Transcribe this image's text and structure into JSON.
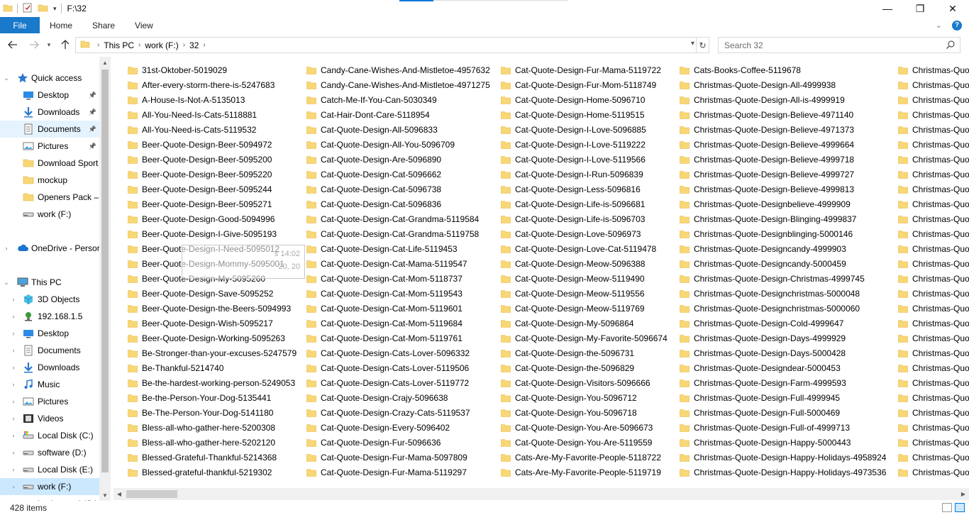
{
  "window": {
    "title": "F:\\32",
    "controls": {
      "minimize": "—",
      "maximize": "❐",
      "close": "✕"
    }
  },
  "ribbon": {
    "tabs": [
      "File",
      "Home",
      "Share",
      "View"
    ],
    "expand_icon": "chevron-down-icon",
    "help_label": "?"
  },
  "address": {
    "crumbs": [
      "This PC",
      "work (F:)",
      "32"
    ],
    "search_placeholder": "Search 32"
  },
  "nav": {
    "items": [
      {
        "label": "Quick access",
        "level": 0,
        "icon": "star",
        "chev": "expanded"
      },
      {
        "label": "Desktop",
        "level": 1,
        "icon": "desktop",
        "pin": true
      },
      {
        "label": "Downloads",
        "level": 1,
        "icon": "download",
        "pin": true
      },
      {
        "label": "Documents",
        "level": 1,
        "icon": "documents",
        "pin": true,
        "state": "hover"
      },
      {
        "label": "Pictures",
        "level": 1,
        "icon": "pictures",
        "pin": true
      },
      {
        "label": "Download Sport",
        "level": 1,
        "icon": "folder"
      },
      {
        "label": "mockup",
        "level": 1,
        "icon": "folder"
      },
      {
        "label": "Openers Pack – \\",
        "level": 1,
        "icon": "folder"
      },
      {
        "label": "work (F:)",
        "level": 1,
        "icon": "drive"
      },
      {
        "label": "",
        "level": 0,
        "icon": "none"
      },
      {
        "label": "OneDrive - Persor",
        "level": 0,
        "icon": "cloud",
        "chev": "collapsed"
      },
      {
        "label": "",
        "level": 0,
        "icon": "none"
      },
      {
        "label": "This PC",
        "level": 0,
        "icon": "pc",
        "chev": "expanded"
      },
      {
        "label": "3D Objects",
        "level": 1,
        "icon": "3d",
        "chev": "collapsed"
      },
      {
        "label": "192.168.1.5",
        "level": 1,
        "icon": "network",
        "chev": "collapsed"
      },
      {
        "label": "Desktop",
        "level": 1,
        "icon": "desktop",
        "chev": "collapsed"
      },
      {
        "label": "Documents",
        "level": 1,
        "icon": "documents",
        "chev": "collapsed"
      },
      {
        "label": "Downloads",
        "level": 1,
        "icon": "download",
        "chev": "collapsed"
      },
      {
        "label": "Music",
        "level": 1,
        "icon": "music",
        "chev": "collapsed"
      },
      {
        "label": "Pictures",
        "level": 1,
        "icon": "pictures",
        "chev": "collapsed"
      },
      {
        "label": "Videos",
        "level": 1,
        "icon": "videos",
        "chev": "collapsed"
      },
      {
        "label": "Local Disk (C:)",
        "level": 1,
        "icon": "drive-c",
        "chev": "collapsed"
      },
      {
        "label": "software (D:)",
        "level": 1,
        "icon": "drive",
        "chev": "collapsed"
      },
      {
        "label": "Local Disk (E:)",
        "level": 1,
        "icon": "drive",
        "chev": "collapsed"
      },
      {
        "label": "work (F:)",
        "level": 1,
        "icon": "drive",
        "chev": "collapsed",
        "state": "selected"
      },
      {
        "label": "backup ssd (G:)",
        "level": 1,
        "icon": "drive",
        "chev": "collapsed"
      }
    ]
  },
  "files": {
    "columns": [
      [
        "31st-Oktober-5019029",
        "After-every-storm-there-is-5247683",
        "A-House-Is-Not-A-5135013",
        "All-You-Need-Is-Cats-5118881",
        "All-You-Need-is-Cats-5119532",
        "Beer-Quote-Design-Beer-5094972",
        "Beer-Quote-Design-Beer-5095200",
        "Beer-Quote-Design-Beer-5095220",
        "Beer-Quote-Design-Beer-5095244",
        "Beer-Quote-Design-Beer-5095271",
        "Beer-Quote-Design-Good-5094996",
        "Beer-Quote-Design-I-Give-5095193",
        "Beer-Quote-Design-I-Need-5095012",
        "Beer-Quote-Design-Mommy-5095001",
        "Beer-Quote-Design-My-5095260",
        "Beer-Quote-Design-Save-5095252",
        "Beer-Quote-Design-the-Beers-5094993",
        "Beer-Quote-Design-Wish-5095217",
        "Beer-Quote-Design-Working-5095263",
        "Be-Stronger-than-your-excuses-5247579",
        "Be-Thankful-5214740",
        "Be-the-hardest-working-person-5249053",
        "Be-the-Person-Your-Dog-5135441",
        "Be-The-Person-Your-Dog-5141180",
        "Bless-all-who-gather-here-5200308",
        "Bless-all-who-gather-here-5202120",
        "Blessed-Grateful-Thankful-5214368",
        "Blessed-grateful-thankful-5219302"
      ],
      [
        "Candy-Cane-Wishes-And-Mistletoe-4957632",
        "Candy-Cane-Wishes-And-Mistletoe-4971275",
        "Catch-Me-If-You-Can-5030349",
        "Cat-Hair-Dont-Care-5118954",
        "Cat-Quote-Design-All-5096833",
        "Cat-Quote-Design-All-You-5096709",
        "Cat-Quote-Design-Are-5096890",
        "Cat-Quote-Design-Cat-5096662",
        "Cat-Quote-Design-Cat-5096738",
        "Cat-Quote-Design-Cat-5096836",
        "Cat-Quote-Design-Cat-Grandma-5119584",
        "Cat-Quote-Design-Cat-Grandma-5119758",
        "Cat-Quote-Design-Cat-Life-5119453",
        "Cat-Quote-Design-Cat-Mama-5119547",
        "Cat-Quote-Design-Cat-Mom-5118737",
        "Cat-Quote-Design-Cat-Mom-5119543",
        "Cat-Quote-Design-Cat-Mom-5119601",
        "Cat-Quote-Design-Cat-Mom-5119684",
        "Cat-Quote-Design-Cat-Mom-5119761",
        "Cat-Quote-Design-Cats-Lover-5096332",
        "Cat-Quote-Design-Cats-Lover-5119506",
        "Cat-Quote-Design-Cats-Lover-5119772",
        "Cat-Quote-Design-Crajy-5096638",
        "Cat-Quote-Design-Crazy-Cats-5119537",
        "Cat-Quote-Design-Every-5096402",
        "Cat-Quote-Design-Fur-5096636",
        "Cat-Quote-Design-Fur-Mama-5097809",
        "Cat-Quote-Design-Fur-Mama-5119297"
      ],
      [
        "Cat-Quote-Design-Fur-Mama-5119722",
        "Cat-Quote-Design-Fur-Mom-5118749",
        "Cat-Quote-Design-Home-5096710",
        "Cat-Quote-Design-Home-5119515",
        "Cat-Quote-Design-I-Love-5096885",
        "Cat-Quote-Design-I-Love-5119222",
        "Cat-Quote-Design-I-Love-5119566",
        "Cat-Quote-Design-I-Run-5096839",
        "Cat-Quote-Design-Less-5096816",
        "Cat-Quote-Design-Life-is-5096681",
        "Cat-Quote-Design-Life-is-5096703",
        "Cat-Quote-Design-Love-5096973",
        "Cat-Quote-Design-Love-Cat-5119478",
        "Cat-Quote-Design-Meow-5096388",
        "Cat-Quote-Design-Meow-5119490",
        "Cat-Quote-Design-Meow-5119556",
        "Cat-Quote-Design-Meow-5119769",
        "Cat-Quote-Design-My-5096864",
        "Cat-Quote-Design-My-Favorite-5096674",
        "Cat-Quote-Design-the-5096731",
        "Cat-Quote-Design-the-5096829",
        "Cat-Quote-Design-Visitors-5096666",
        "Cat-Quote-Design-You-5096712",
        "Cat-Quote-Design-You-5096718",
        "Cat-Quote-Design-You-Are-5096673",
        "Cat-Quote-Design-You-Are-5119559",
        "Cats-Are-My-Favorite-People-5118722",
        "Cats-Are-My-Favorite-People-5119719"
      ],
      [
        "Cats-Books-Coffee-5119678",
        "Christmas-Quote-Design-All-4999938",
        "Christmas-Quote-Design-All-is-4999919",
        "Christmas-Quote-Design-Believe-4971140",
        "Christmas-Quote-Design-Believe-4971373",
        "Christmas-Quote-Design-Believe-4999664",
        "Christmas-Quote-Design-Believe-4999718",
        "Christmas-Quote-Design-Believe-4999727",
        "Christmas-Quote-Design-Believe-4999813",
        "Christmas-Quote-Designbelieve-4999909",
        "Christmas-Quote-Design-Blinging-4999837",
        "Christmas-Quote-Designblinging-5000146",
        "Christmas-Quote-Designcandy-4999903",
        "Christmas-Quote-Designcandy-5000459",
        "Christmas-Quote-Design-Christmas-4999745",
        "Christmas-Quote-Designchristmas-5000048",
        "Christmas-Quote-Designchristmas-5000060",
        "Christmas-Quote-Design-Cold-4999647",
        "Christmas-Quote-Design-Days-4999929",
        "Christmas-Quote-Design-Days-5000428",
        "Christmas-Quote-Designdear-5000453",
        "Christmas-Quote-Design-Farm-4999593",
        "Christmas-Quote-Design-Full-4999945",
        "Christmas-Quote-Design-Full-5000469",
        "Christmas-Quote-Design-Full-of-4999713",
        "Christmas-Quote-Design-Happy-5000443",
        "Christmas-Quote-Design-Happy-Holidays-4958924",
        "Christmas-Quote-Design-Happy-Holidays-4973536"
      ],
      [
        "Christmas-Quot",
        "Christmas-Quot",
        "Christmas-Quot",
        "Christmas-Quot",
        "Christmas-Quot",
        "Christmas-Quot",
        "Christmas-Quot",
        "Christmas-Quot",
        "Christmas-Quot",
        "Christmas-Quot",
        "Christmas-Quot",
        "Christmas-Quot",
        "Christmas-Quot",
        "Christmas-Quot",
        "Christmas-Quot",
        "Christmas-Quot",
        "Christmas-Quot",
        "Christmas-Quot",
        "Christmas-Quot",
        "Christmas-Quot",
        "Christmas-Quot",
        "Christmas-Quot",
        "Christmas-Quot",
        "Christmas-Quot",
        "Christmas-Quot",
        "Christmas-Quot",
        "Christmas-Quot",
        "Christmas-Quot"
      ]
    ]
  },
  "tooltip": {
    "lines": [
      "s 14:02",
      "20, 20"
    ]
  },
  "status": {
    "item_count": "428 items"
  },
  "colors": {
    "accent": "#1979ca",
    "folder": "#f8d775",
    "folder_dark": "#e8b84a",
    "selected": "#cce8ff"
  }
}
